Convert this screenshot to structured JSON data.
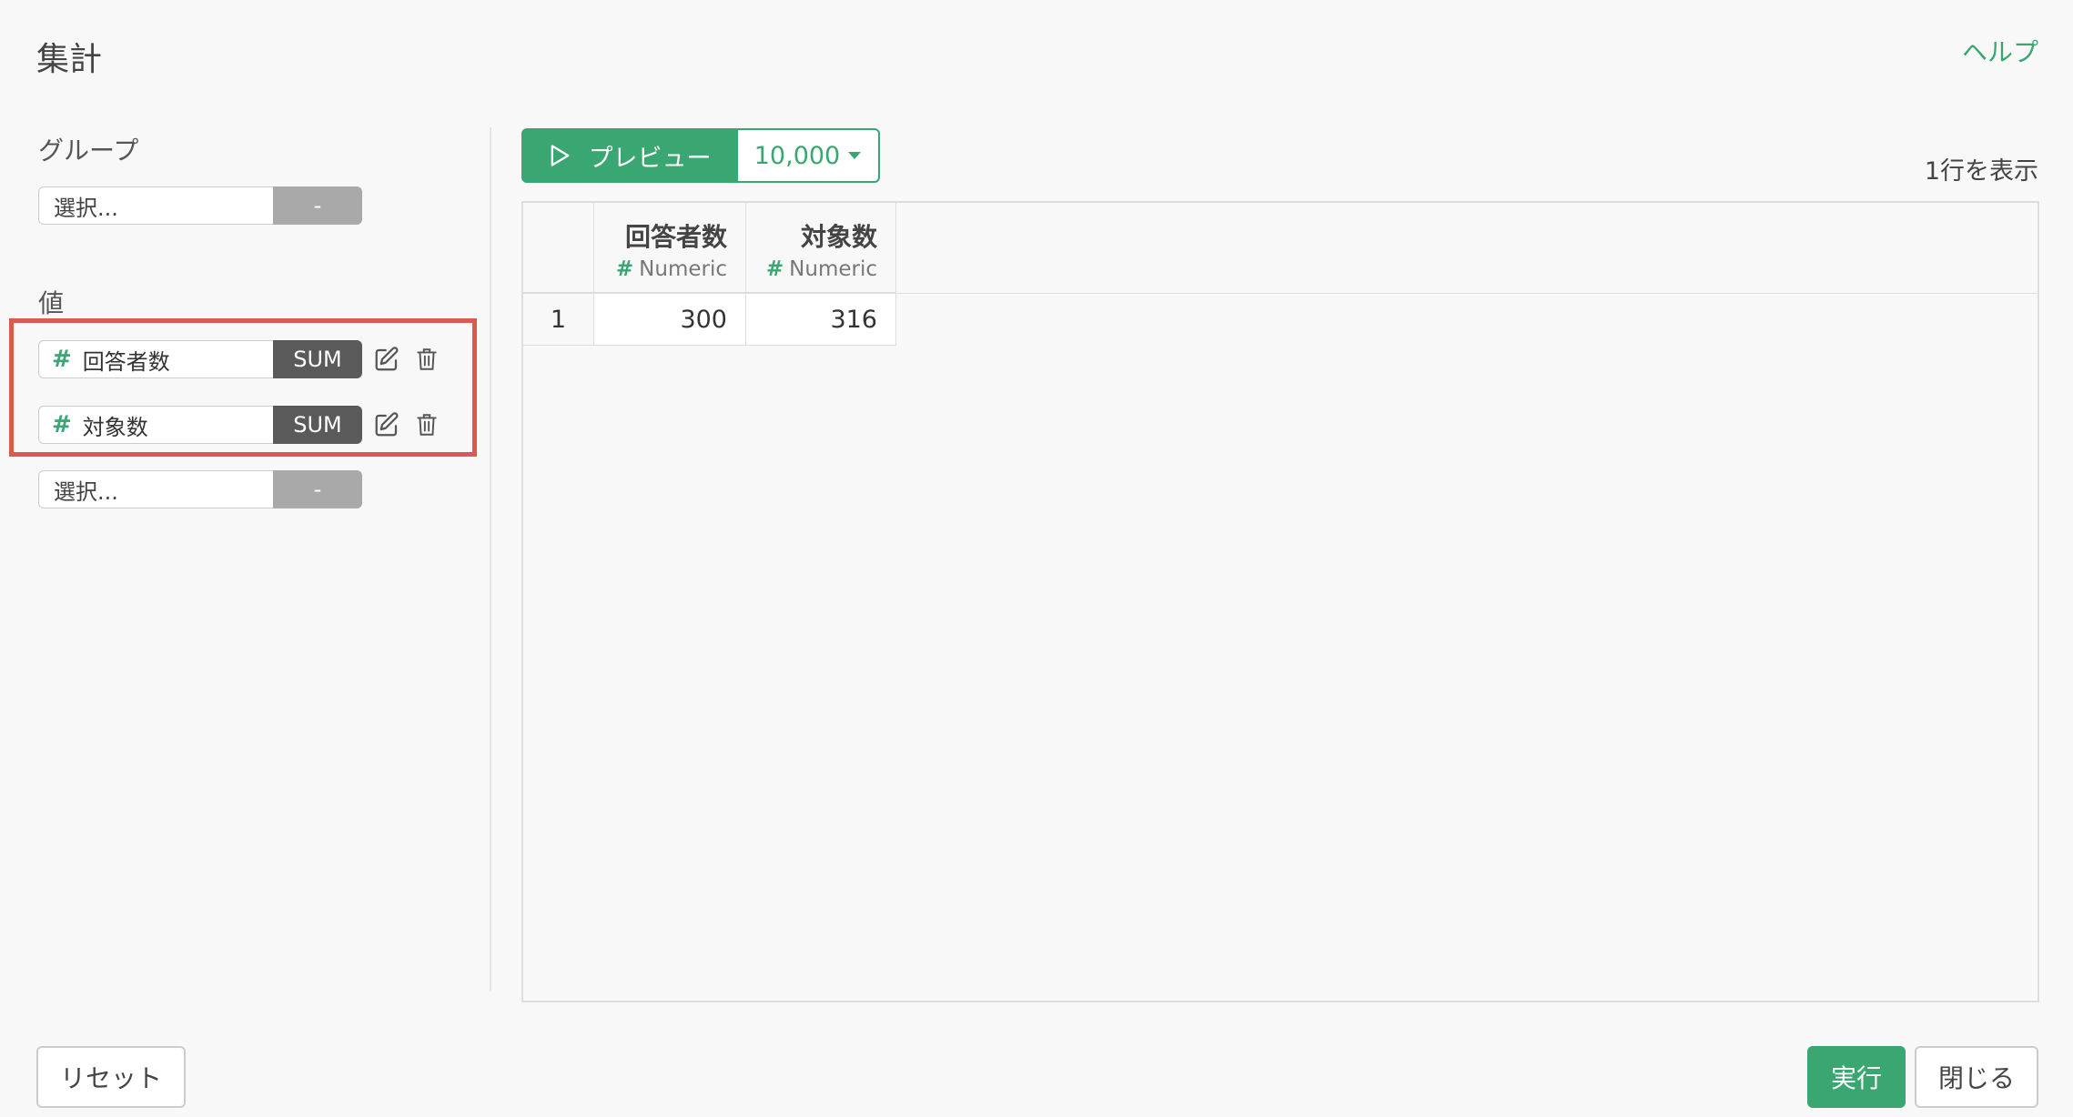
{
  "header": {
    "title": "集計",
    "help_label": "ヘルプ"
  },
  "group_section": {
    "label": "グループ",
    "select_placeholder": "選択...",
    "select_button": "-"
  },
  "value_section": {
    "label": "値",
    "items": [
      {
        "icon": "hash-icon",
        "name": "回答者数",
        "agg": "SUM"
      },
      {
        "icon": "hash-icon",
        "name": "対象数",
        "agg": "SUM"
      }
    ],
    "select_placeholder": "選択...",
    "select_button": "-"
  },
  "preview": {
    "button_label": "プレビュー",
    "row_limit": "10,000",
    "row_count_text": "1行を表示"
  },
  "table": {
    "columns": [
      {
        "name": "回答者数",
        "type": "Numeric"
      },
      {
        "name": "対象数",
        "type": "Numeric"
      }
    ],
    "rows": [
      {
        "index": "1",
        "cells": [
          "300",
          "316"
        ]
      }
    ]
  },
  "footer": {
    "reset_label": "リセット",
    "run_label": "実行",
    "close_label": "閉じる"
  },
  "colors": {
    "accent": "#3aa671",
    "highlight": "#d95b50",
    "sum_button": "#5a5a5a"
  }
}
